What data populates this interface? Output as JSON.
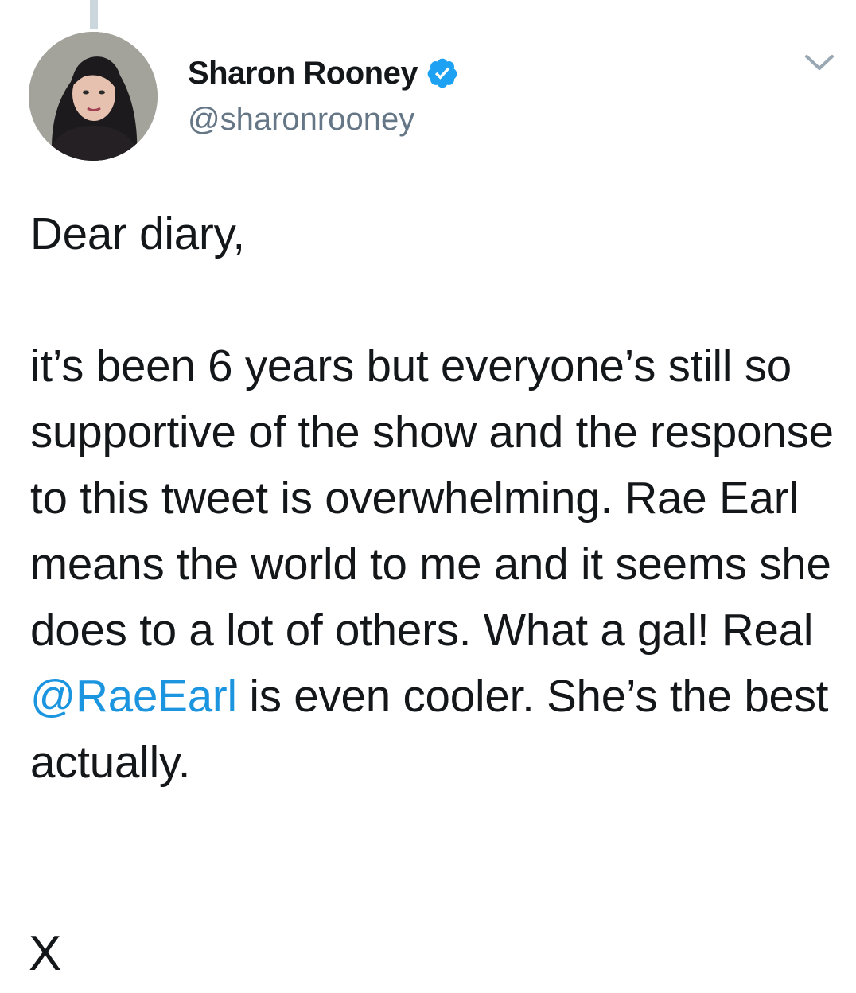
{
  "author": {
    "display_name": "Sharon Rooney",
    "handle": "@sharonrooney",
    "verified_icon": "verified-badge-icon",
    "avatar_icon": "profile-photo"
  },
  "tweet": {
    "paragraph_1": "Dear diary,",
    "paragraph_2_start": "it’s been 6 years but everyone’s still so supportive of the show and the response to this tweet is overwhelming. Rae Earl means the world to me and it seems she does to a lot of others. What a gal! Real ",
    "mention": "@RaeEarl",
    "paragraph_2_end": " is even cooler. She’s the best actually."
  },
  "menu_icon": "chevron-down-icon",
  "close_label": "X",
  "colors": {
    "text": "#14171a",
    "secondary_text": "#657786",
    "link": "#1b95e0",
    "verified": "#1da1f2",
    "thread_line": "#ccd6dd"
  }
}
